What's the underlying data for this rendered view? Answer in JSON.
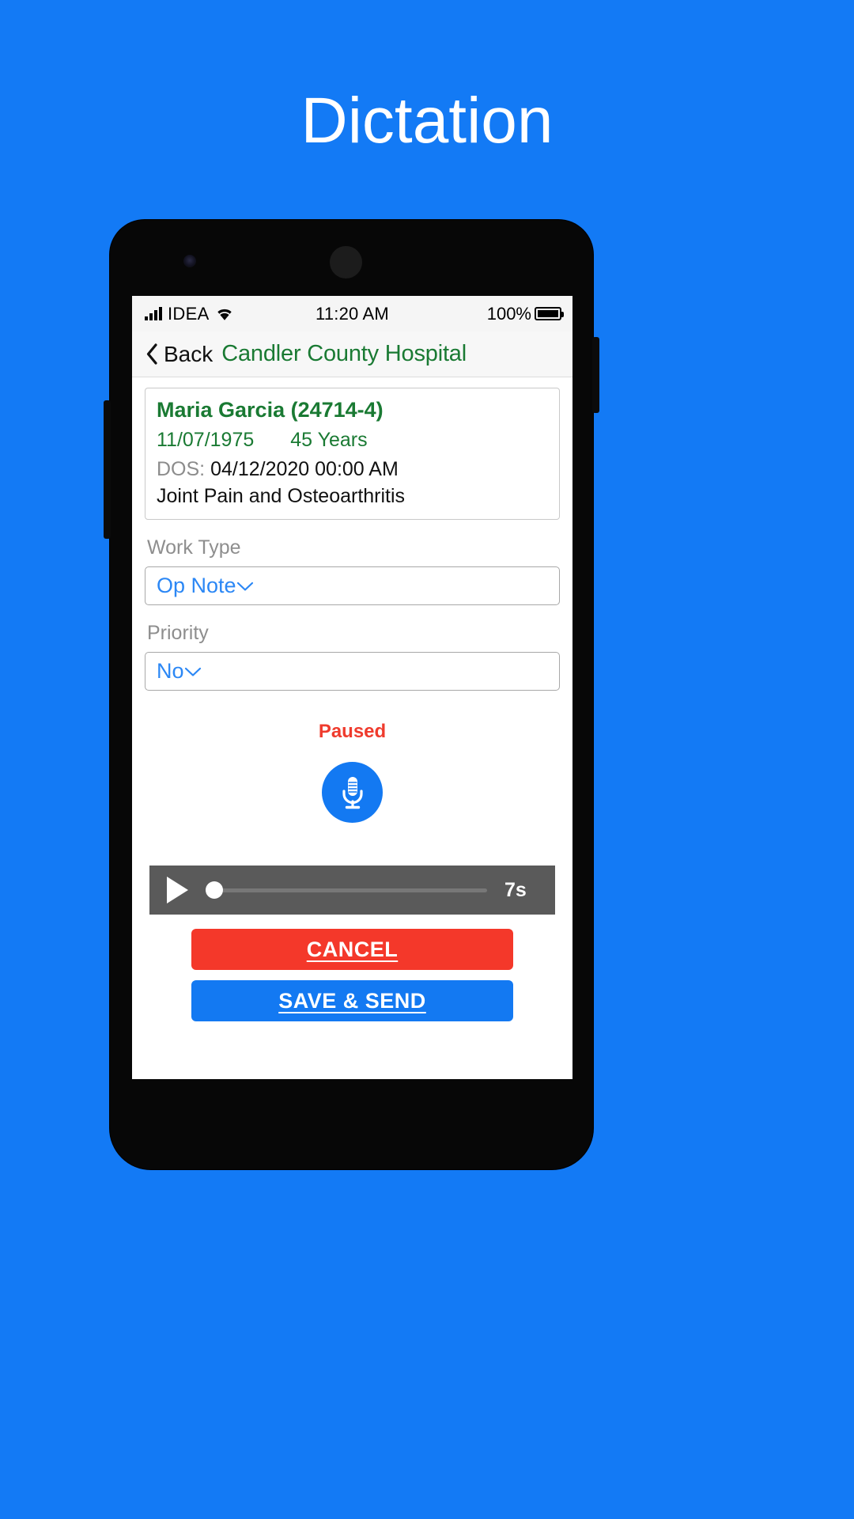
{
  "page": {
    "title": "Dictation",
    "background_color": "#137af5"
  },
  "status_bar": {
    "signal_icon": "signal-bars-icon",
    "carrier": "IDEA",
    "wifi_icon": "wifi-icon",
    "time": "11:20 AM",
    "battery_percent": "100%",
    "battery_icon": "battery-full-icon"
  },
  "nav_bar": {
    "back_icon": "chevron-left-icon",
    "back_label": "Back",
    "title": "Candler County Hospital",
    "title_color": "#1a7a33"
  },
  "patient": {
    "name": "Maria Garcia (24714-4)",
    "dob": "11/07/1975",
    "age": "45 Years",
    "dos_label": "DOS:",
    "dos_value": "04/12/2020 00:00 AM",
    "diagnosis": "Joint Pain and Osteoarthritis"
  },
  "work_type": {
    "label": "Work Type",
    "value": "Op Note",
    "caret_icon": "chevron-down-icon"
  },
  "priority": {
    "label": "Priority",
    "value": "No",
    "caret_icon": "chevron-down-icon"
  },
  "recorder": {
    "status": "Paused",
    "status_color": "#ef3b2d",
    "mic_icon": "microphone-icon",
    "mic_button_color": "#1379f2"
  },
  "player": {
    "play_icon": "play-icon",
    "progress_percent": 0,
    "duration": "7s"
  },
  "actions": {
    "cancel_label": "CANCEL",
    "cancel_color": "#f4382a",
    "save_label": "SAVE & SEND",
    "save_color": "#1379f2"
  }
}
